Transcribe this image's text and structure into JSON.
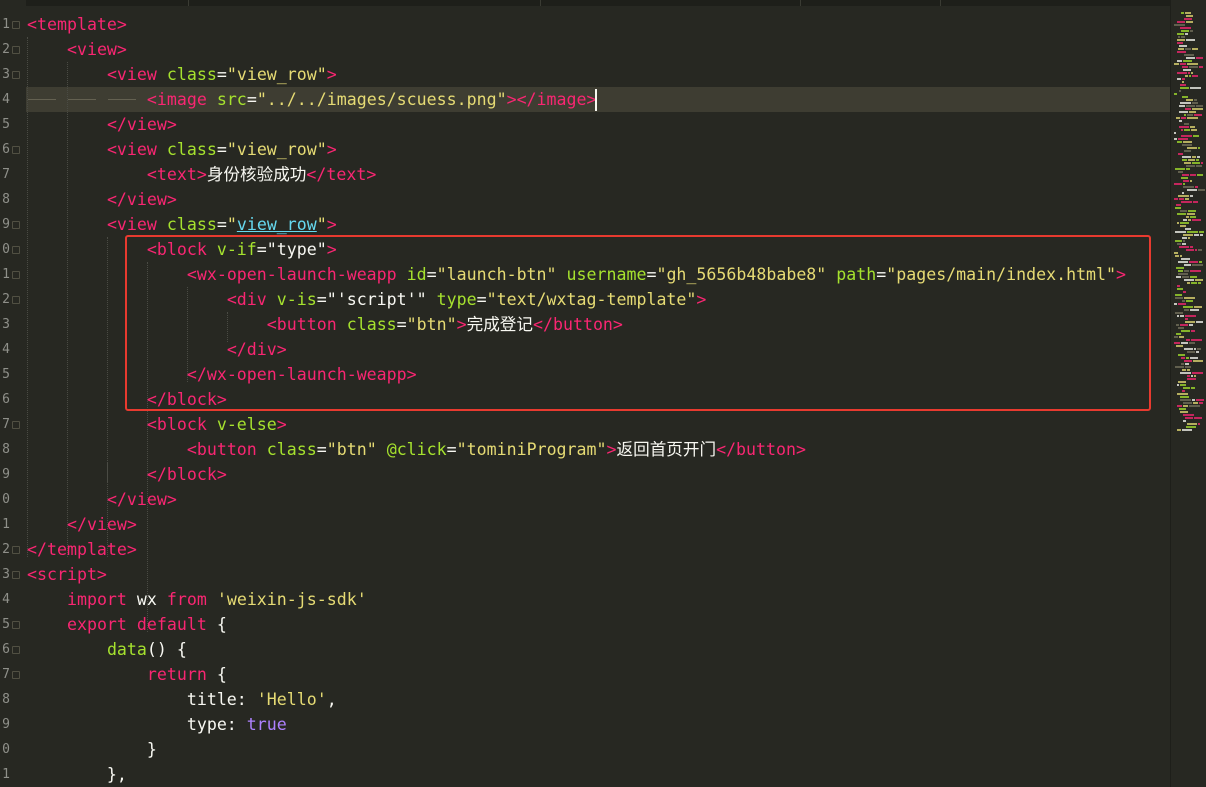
{
  "editor": {
    "theme_colors": {
      "background": "#272822",
      "tag": "#f92672",
      "attribute": "#a6e22e",
      "string": "#e6db74",
      "constant": "#ae81ff",
      "text": "#f8f8f2",
      "highlight_box": "#e83a2f"
    },
    "line_numbers": [
      "1",
      "2",
      "3",
      "4",
      "5",
      "6",
      "7",
      "8",
      "9",
      "0",
      "1",
      "2",
      "3",
      "4",
      "5",
      "6",
      "7",
      "8",
      "9",
      "0",
      "1",
      "2",
      "3",
      "4",
      "5",
      "6",
      "7",
      "8",
      "9",
      "0",
      "1"
    ],
    "lines": [
      [
        {
          "t": "tag",
          "v": "<template>"
        }
      ],
      [
        {
          "t": "p",
          "v": "    "
        },
        {
          "t": "tag",
          "v": "<view>"
        }
      ],
      [
        {
          "t": "p",
          "v": "        "
        },
        {
          "t": "tag",
          "v": "<view "
        },
        {
          "t": "attr",
          "v": "class"
        },
        {
          "t": "p",
          "v": "="
        },
        {
          "t": "str",
          "v": "\"view_row\""
        },
        {
          "t": "tag",
          "v": ">"
        }
      ],
      [
        {
          "t": "p",
          "v": "            "
        },
        {
          "t": "tag",
          "v": "<image "
        },
        {
          "t": "attr",
          "v": "src"
        },
        {
          "t": "p",
          "v": "="
        },
        {
          "t": "str",
          "v": "\"../../images/scuess.png\""
        },
        {
          "t": "tag",
          "v": "></image>"
        }
      ],
      [
        {
          "t": "p",
          "v": "        "
        },
        {
          "t": "tag",
          "v": "</view>"
        }
      ],
      [
        {
          "t": "p",
          "v": "        "
        },
        {
          "t": "tag",
          "v": "<view "
        },
        {
          "t": "attr",
          "v": "class"
        },
        {
          "t": "p",
          "v": "="
        },
        {
          "t": "str",
          "v": "\"view_row\""
        },
        {
          "t": "tag",
          "v": ">"
        }
      ],
      [
        {
          "t": "p",
          "v": "            "
        },
        {
          "t": "tag",
          "v": "<text"
        },
        {
          "t": "tag",
          "v": ">"
        },
        {
          "t": "p",
          "v": "身份核验成功"
        },
        {
          "t": "tag",
          "v": "</text>"
        }
      ],
      [
        {
          "t": "p",
          "v": "        "
        },
        {
          "t": "tag",
          "v": "</view>"
        }
      ],
      [
        {
          "t": "p",
          "v": "        "
        },
        {
          "t": "tag",
          "v": "<view "
        },
        {
          "t": "attr",
          "v": "class"
        },
        {
          "t": "p",
          "v": "="
        },
        {
          "t": "str",
          "v": "\""
        },
        {
          "t": "sq",
          "v": "view_row"
        },
        {
          "t": "str",
          "v": "\""
        },
        {
          "t": "tag",
          "v": ">"
        }
      ],
      [
        {
          "t": "p",
          "v": "            "
        },
        {
          "t": "tag",
          "v": "<block "
        },
        {
          "t": "attr",
          "v": "v-if"
        },
        {
          "t": "p",
          "v": "="
        },
        {
          "t": "p",
          "v": "\"type\""
        },
        {
          "t": "tag",
          "v": ">"
        }
      ],
      [
        {
          "t": "p",
          "v": "                "
        },
        {
          "t": "tag",
          "v": "<wx-open-launch-weapp "
        },
        {
          "t": "attr",
          "v": "id"
        },
        {
          "t": "p",
          "v": "="
        },
        {
          "t": "str",
          "v": "\"launch-btn\" "
        },
        {
          "t": "attr",
          "v": "username"
        },
        {
          "t": "p",
          "v": "="
        },
        {
          "t": "str",
          "v": "\"gh_5656b48babe8\" "
        },
        {
          "t": "attr",
          "v": "path"
        },
        {
          "t": "p",
          "v": "="
        },
        {
          "t": "str",
          "v": "\"pages/main/index.html\""
        },
        {
          "t": "tag",
          "v": ">"
        }
      ],
      [
        {
          "t": "p",
          "v": "                    "
        },
        {
          "t": "tag",
          "v": "<div "
        },
        {
          "t": "attr",
          "v": "v-is"
        },
        {
          "t": "p",
          "v": "="
        },
        {
          "t": "p",
          "v": "\"'script'\" "
        },
        {
          "t": "attr",
          "v": "type"
        },
        {
          "t": "p",
          "v": "="
        },
        {
          "t": "str",
          "v": "\"text/wxtag-template\""
        },
        {
          "t": "tag",
          "v": ">"
        }
      ],
      [
        {
          "t": "p",
          "v": "                        "
        },
        {
          "t": "tag",
          "v": "<button "
        },
        {
          "t": "attr",
          "v": "class"
        },
        {
          "t": "p",
          "v": "="
        },
        {
          "t": "str",
          "v": "\"btn\""
        },
        {
          "t": "tag",
          "v": ">"
        },
        {
          "t": "p",
          "v": "完成登记"
        },
        {
          "t": "tag",
          "v": "</button>"
        }
      ],
      [
        {
          "t": "p",
          "v": "                    "
        },
        {
          "t": "tag",
          "v": "</div>"
        }
      ],
      [
        {
          "t": "p",
          "v": "                "
        },
        {
          "t": "tag",
          "v": "</wx-open-launch-weapp>"
        }
      ],
      [
        {
          "t": "p",
          "v": "            "
        },
        {
          "t": "tag",
          "v": "</block>"
        }
      ],
      [
        {
          "t": "p",
          "v": "            "
        },
        {
          "t": "tag",
          "v": "<block "
        },
        {
          "t": "attr",
          "v": "v-else"
        },
        {
          "t": "tag",
          "v": ">"
        }
      ],
      [
        {
          "t": "p",
          "v": "                "
        },
        {
          "t": "tag",
          "v": "<button "
        },
        {
          "t": "attr",
          "v": "class"
        },
        {
          "t": "p",
          "v": "="
        },
        {
          "t": "str",
          "v": "\"btn\" "
        },
        {
          "t": "attr",
          "v": "@click"
        },
        {
          "t": "p",
          "v": "="
        },
        {
          "t": "str",
          "v": "\"tominiProgram\""
        },
        {
          "t": "tag",
          "v": ">"
        },
        {
          "t": "p",
          "v": "返回首页开门"
        },
        {
          "t": "tag",
          "v": "</button>"
        }
      ],
      [
        {
          "t": "p",
          "v": "            "
        },
        {
          "t": "tag",
          "v": "</block>"
        }
      ],
      [
        {
          "t": "p",
          "v": "        "
        },
        {
          "t": "tag",
          "v": "</view>"
        }
      ],
      [
        {
          "t": "p",
          "v": "    "
        },
        {
          "t": "tag",
          "v": "</view>"
        }
      ],
      [
        {
          "t": "tag",
          "v": "</template>"
        }
      ],
      [
        {
          "t": "tag",
          "v": "<script>"
        }
      ],
      [
        {
          "t": "p",
          "v": "    "
        },
        {
          "t": "kw",
          "v": "import "
        },
        {
          "t": "p",
          "v": "wx "
        },
        {
          "t": "kw",
          "v": "from "
        },
        {
          "t": "str",
          "v": "'weixin-js-sdk'"
        }
      ],
      [
        {
          "t": "p",
          "v": "    "
        },
        {
          "t": "kw",
          "v": "export default "
        },
        {
          "t": "p",
          "v": "{"
        }
      ],
      [
        {
          "t": "p",
          "v": "        "
        },
        {
          "t": "fn",
          "v": "data"
        },
        {
          "t": "p",
          "v": "() {"
        }
      ],
      [
        {
          "t": "p",
          "v": "            "
        },
        {
          "t": "kw",
          "v": "return "
        },
        {
          "t": "p",
          "v": "{"
        }
      ],
      [
        {
          "t": "p",
          "v": "                title: "
        },
        {
          "t": "str",
          "v": "'Hello'"
        },
        {
          "t": "p",
          "v": ","
        }
      ],
      [
        {
          "t": "p",
          "v": "                type: "
        },
        {
          "t": "const",
          "v": "true"
        }
      ],
      [
        {
          "t": "p",
          "v": "            }"
        }
      ],
      [
        {
          "t": "p",
          "v": "        },"
        }
      ]
    ]
  }
}
